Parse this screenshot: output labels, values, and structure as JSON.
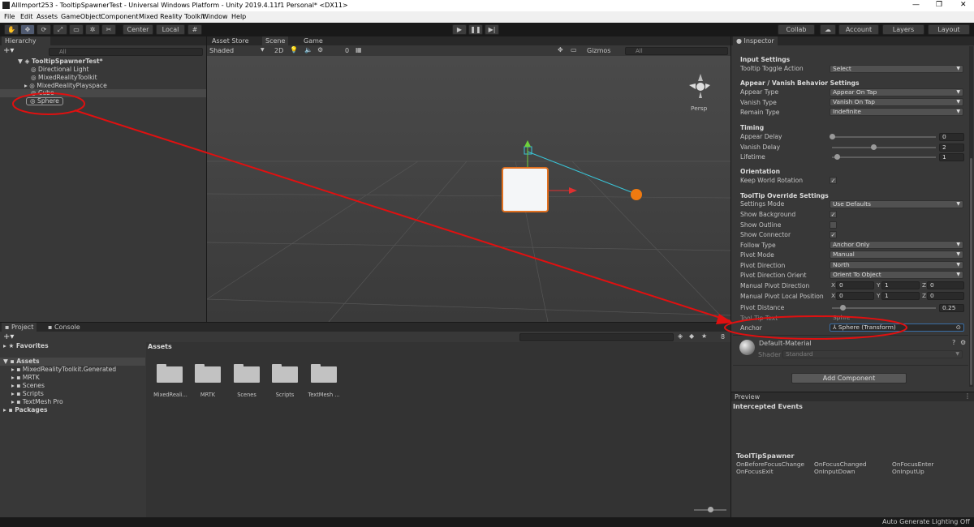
{
  "window": {
    "title": "AllImport253 - TooltipSpawnerTest - Universal Windows Platform - Unity 2019.4.11f1 Personal* <DX11>",
    "min": "—",
    "max": "❐",
    "close": "✕"
  },
  "menu": [
    "File",
    "Edit",
    "Assets",
    "GameObject",
    "Component",
    "Mixed Reality Toolkit",
    "Window",
    "Help"
  ],
  "toolbar": {
    "center": "Center",
    "local": "Local",
    "collab": "Collab",
    "account": "Account",
    "layers": "Layers",
    "layout": "Layout"
  },
  "hierarchy": {
    "tab": "Hierarchy",
    "search_placeholder": "All",
    "scene": "TooltipSpawnerTest*",
    "items": [
      "Directional Light",
      "MixedRealityToolkit",
      "MixedRealityPlayspace",
      "Cube",
      "Sphere"
    ]
  },
  "scene_view": {
    "tabs": [
      "Asset Store",
      "Scene",
      "Game"
    ],
    "shading": "Shaded",
    "mode2d": "2D",
    "gizmos": "Gizmos",
    "search_placeholder": "All",
    "persp": "Persp",
    "hidden_count": "0"
  },
  "project": {
    "tabs": [
      "Project",
      "Console"
    ],
    "favorites": "Favorites",
    "assets_root": "Assets",
    "asset_tree": [
      "MixedRealityToolkit.Generated",
      "MRTK",
      "Scenes",
      "Scripts",
      "TextMesh Pro"
    ],
    "packages": "Packages",
    "breadcrumb": "Assets",
    "folders": [
      "MixedReali...",
      "MRTK",
      "Scenes",
      "Scripts",
      "TextMesh ..."
    ],
    "hidden_count": "8"
  },
  "inspector": {
    "tab": "Inspector",
    "input_settings": {
      "header": "Input Settings",
      "tooltip_toggle_action_label": "Tooltip Toggle Action",
      "tooltip_toggle_action": "Select"
    },
    "appear": {
      "header": "Appear / Vanish Behavior Settings",
      "appear_type_label": "Appear Type",
      "appear_type": "Appear On Tap",
      "vanish_type_label": "Vanish Type",
      "vanish_type": "Vanish On Tap",
      "remain_type_label": "Remain Type",
      "remain_type": "Indefinite"
    },
    "timing": {
      "header": "Timing",
      "appear_delay_label": "Appear Delay",
      "appear_delay": "0",
      "appear_delay_frac": 0.0,
      "vanish_delay_label": "Vanish Delay",
      "vanish_delay": "2",
      "vanish_delay_frac": 0.4,
      "lifetime_label": "Lifetime",
      "lifetime": "1",
      "lifetime_frac": 0.05
    },
    "orientation": {
      "header": "Orientation",
      "keep_world_rotation_label": "Keep World Rotation"
    },
    "override": {
      "header": "ToolTip Override Settings",
      "settings_mode_label": "Settings Mode",
      "settings_mode": "Use Defaults",
      "show_background_label": "Show Background",
      "show_outline_label": "Show Outline",
      "show_connector_label": "Show Connector",
      "follow_type_label": "Follow Type",
      "follow_type": "Anchor Only",
      "pivot_mode_label": "Pivot Mode",
      "pivot_mode": "Manual",
      "pivot_direction_label": "Pivot Direction",
      "pivot_direction": "North",
      "pivot_direction_orient_label": "Pivot Direction Orient",
      "pivot_direction_orient": "Orient To Object",
      "manual_pivot_direction_label": "Manual Pivot Direction",
      "mpd": {
        "x": "0",
        "y": "1",
        "z": "0"
      },
      "manual_pivot_local_position_label": "Manual Pivot Local Position",
      "mplp": {
        "x": "0",
        "y": "1",
        "z": "0"
      },
      "pivot_distance_label": "Pivot Distance",
      "pivot_distance": "0.25",
      "pivot_distance_frac": 0.1,
      "tool_tip_text_label": "Tool Tip Text",
      "tool_tip_text": "Sphre",
      "anchor_label": "Anchor",
      "anchor": "Sphere (Transform)"
    },
    "material": {
      "name": "Default-Material",
      "shader_label": "Shader",
      "shader": "Standard"
    },
    "add_component": "Add Component",
    "axis": {
      "x": "X",
      "y": "Y",
      "z": "Z"
    }
  },
  "preview": {
    "tab": "Preview",
    "intercepted": "Intercepted Events",
    "spawner": "ToolTipSpawner",
    "events": [
      "OnBeforeFocusChange",
      "OnFocusChanged",
      "OnFocusEnter",
      "OnFocusExit",
      "OnInputDown",
      "OnInputUp"
    ]
  },
  "status": {
    "right": "Auto Generate Lighting Off"
  },
  "colors": {
    "annotation": "#e01010",
    "selection": "#e07020",
    "axis_green": "#6ed13a",
    "connector": "#39c5d8"
  }
}
